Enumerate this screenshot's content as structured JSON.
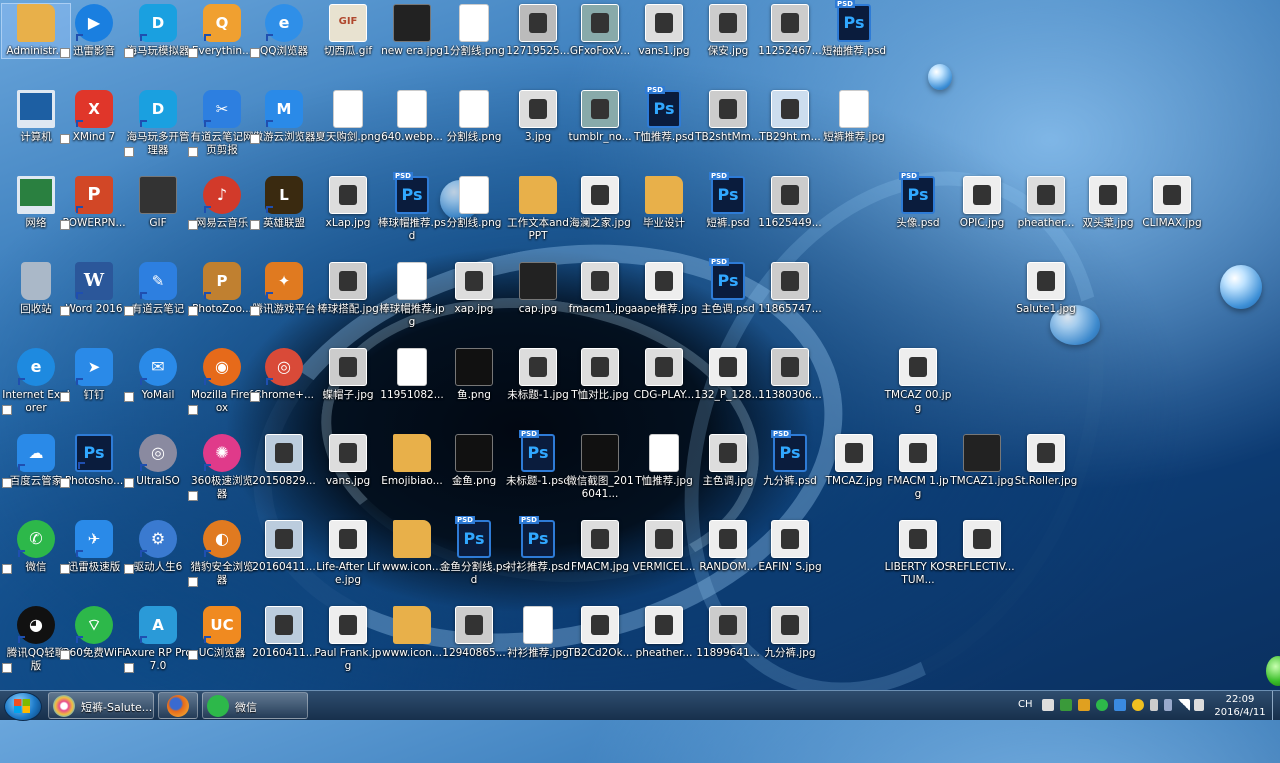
{
  "desktop": {
    "icons": [
      {
        "label": "Administr...",
        "kind": "folder",
        "c": "#e8b04a"
      },
      {
        "label": "迅雷影音",
        "kind": "round",
        "c": "#1a7fe0",
        "g": "▶"
      },
      {
        "label": "海马玩模拟器",
        "kind": "app",
        "c": "#1aa0e0",
        "g": "D"
      },
      {
        "label": "Everythin...",
        "kind": "app",
        "c": "#f0a030",
        "g": "Q"
      },
      {
        "label": "QQ浏览器",
        "kind": "round",
        "c": "#2f8fe8",
        "g": "e"
      },
      {
        "label": "切西瓜.gif",
        "kind": "gif",
        "c": "#e8e2d0"
      },
      {
        "label": "new era.jpg",
        "kind": "dark",
        "c": "#222"
      },
      {
        "label": "1分割线.png",
        "kind": "file",
        "c": "#fff"
      },
      {
        "label": "12719525...",
        "kind": "photo",
        "c": "#bbb"
      },
      {
        "label": "GFxoFoxV...",
        "kind": "photo",
        "c": "#8aa"
      },
      {
        "label": "vans1.jpg",
        "kind": "photo",
        "c": "#ddd"
      },
      {
        "label": "保安.jpg",
        "kind": "photo",
        "c": "#ccc"
      },
      {
        "label": "11252467...",
        "kind": "photo",
        "c": "#ccc"
      },
      {
        "label": "短袖推荐.psd",
        "kind": "psd",
        "c": "#0a1c3d",
        "g": "Ps"
      },
      {
        "label": "计算机",
        "kind": "pc",
        "c": "#1d5fa3"
      },
      {
        "label": "XMind 7",
        "kind": "app",
        "c": "#e0362a",
        "g": "X"
      },
      {
        "label": "海马玩多开管理器",
        "kind": "app",
        "c": "#1aa0e0",
        "g": "D"
      },
      {
        "label": "有道云笔记网页剪报",
        "kind": "app",
        "c": "#2d7fe0",
        "g": "✂"
      },
      {
        "label": "傲游云浏览器",
        "kind": "app",
        "c": "#2a8ae8",
        "g": "M"
      },
      {
        "label": "夏天购剑.png",
        "kind": "file",
        "c": "#fff"
      },
      {
        "label": "640.webp...",
        "kind": "file",
        "c": "#fff"
      },
      {
        "label": "分割线.png",
        "kind": "file",
        "c": "#fff"
      },
      {
        "label": "3.jpg",
        "kind": "photo",
        "c": "#ddd"
      },
      {
        "label": "tumblr_no...",
        "kind": "photo",
        "c": "#8aa"
      },
      {
        "label": "T恤推荐.psd",
        "kind": "psd",
        "c": "#0a1c3d",
        "g": "Ps"
      },
      {
        "label": "TB2shtMm...",
        "kind": "photo",
        "c": "#ccc"
      },
      {
        "label": "TB29ht.m...",
        "kind": "photo",
        "c": "#cde"
      },
      {
        "label": "短裤推荐.jpg",
        "kind": "file",
        "c": "#fff"
      },
      {
        "label": "网络",
        "kind": "pc",
        "c": "#2a8040"
      },
      {
        "label": "POWERPN...",
        "kind": "ppt",
        "c": "#d24726",
        "g": "P"
      },
      {
        "label": "GIF",
        "kind": "dark",
        "c": "#333"
      },
      {
        "label": "网易云音乐",
        "kind": "round",
        "c": "#d23a2a",
        "g": "♪"
      },
      {
        "label": "英雄联盟",
        "kind": "app",
        "c": "#3a2a10",
        "g": "L"
      },
      {
        "label": "xLap.jpg",
        "kind": "photo",
        "c": "#ddd"
      },
      {
        "label": "棒球帽推荐.psd",
        "kind": "psd",
        "c": "#0a1c3d",
        "g": "Ps"
      },
      {
        "label": "分割线.png",
        "kind": "file",
        "c": "#fff"
      },
      {
        "label": "工作文本andPPT",
        "kind": "folder",
        "c": "#e8b04a"
      },
      {
        "label": "海澜之家.jpg",
        "kind": "photo",
        "c": "#eee"
      },
      {
        "label": "毕业设计",
        "kind": "folder",
        "c": "#e8b04a"
      },
      {
        "label": "短裤.psd",
        "kind": "psd",
        "c": "#0a1c3d",
        "g": "Ps"
      },
      {
        "label": "11625449...",
        "kind": "photo",
        "c": "#ccc"
      },
      {
        "label": "头像.psd",
        "kind": "psd",
        "c": "#0a1c3d",
        "g": "Ps"
      },
      {
        "label": "OPIC.jpg",
        "kind": "photo",
        "c": "#eee"
      },
      {
        "label": "pheather...",
        "kind": "photo",
        "c": "#ddd"
      },
      {
        "label": "双头葉.jpg",
        "kind": "photo",
        "c": "#eee"
      },
      {
        "label": "CLIMAX.jpg",
        "kind": "photo",
        "c": "#eee"
      },
      {
        "label": "回收站",
        "kind": "bin",
        "c": "#aab8c8"
      },
      {
        "label": "Word 2016",
        "kind": "word",
        "c": "#2b579a",
        "g": "W"
      },
      {
        "label": "有道云笔记",
        "kind": "app",
        "c": "#2d7fe0",
        "g": "✎"
      },
      {
        "label": "PhotoZoo...",
        "kind": "app",
        "c": "#c08030",
        "g": "P"
      },
      {
        "label": "腾讯游戏平台",
        "kind": "app",
        "c": "#e07a20",
        "g": "✦"
      },
      {
        "label": "棒球搭配.jpg",
        "kind": "photo",
        "c": "#ccc"
      },
      {
        "label": "棒球帽推荐.jpg",
        "kind": "file",
        "c": "#fff"
      },
      {
        "label": "xap.jpg",
        "kind": "photo",
        "c": "#ddd"
      },
      {
        "label": "cap.jpg",
        "kind": "dark",
        "c": "#222"
      },
      {
        "label": "fmacm1.jpg",
        "kind": "photo",
        "c": "#ddd"
      },
      {
        "label": "aape推荐.jpg",
        "kind": "photo",
        "c": "#eee"
      },
      {
        "label": "主色调.psd",
        "kind": "psd",
        "c": "#0a1c3d",
        "g": "Ps"
      },
      {
        "label": "11865747...",
        "kind": "photo",
        "c": "#ccc"
      },
      {
        "label": "Salute1.jpg",
        "kind": "photo",
        "c": "#eee"
      },
      {
        "label": "Internet Explorer",
        "kind": "round",
        "c": "#1e8ae0",
        "g": "e"
      },
      {
        "label": "钉钉",
        "kind": "app",
        "c": "#2a8ae8",
        "g": "➤"
      },
      {
        "label": "YoMail",
        "kind": "round",
        "c": "#2a8ae8",
        "g": "✉"
      },
      {
        "label": "Mozilla Firefox",
        "kind": "round",
        "c": "#e66a1a",
        "g": "◉"
      },
      {
        "label": "Chrome+...",
        "kind": "round",
        "c": "#d94a38",
        "g": "◎"
      },
      {
        "label": "蝶帽子.jpg",
        "kind": "photo",
        "c": "#ccc"
      },
      {
        "label": "11951082...",
        "kind": "file",
        "c": "#fff"
      },
      {
        "label": "鱼.png",
        "kind": "dark",
        "c": "#111"
      },
      {
        "label": "未标题-1.jpg",
        "kind": "photo",
        "c": "#ddd"
      },
      {
        "label": "T恤对比.jpg",
        "kind": "photo",
        "c": "#ddd"
      },
      {
        "label": "CDG-PLAY...",
        "kind": "photo",
        "c": "#ddd"
      },
      {
        "label": "132_P_128...",
        "kind": "photo",
        "c": "#eee"
      },
      {
        "label": "11380306...",
        "kind": "photo",
        "c": "#ccc"
      },
      {
        "label": "TMCAZ 00.jpg",
        "kind": "photo",
        "c": "#eee"
      },
      {
        "label": "百度云管家",
        "kind": "app",
        "c": "#2a8ae8",
        "g": "☁"
      },
      {
        "label": "Photosho...",
        "kind": "ps",
        "c": "#0a1c3d",
        "g": "Ps"
      },
      {
        "label": "UltraISO",
        "kind": "round",
        "c": "#8a8aa0",
        "g": "◎"
      },
      {
        "label": "360极速浏览器",
        "kind": "round",
        "c": "#e03a8a",
        "g": "✺"
      },
      {
        "label": "20150829...",
        "kind": "photo",
        "c": "#bcd"
      },
      {
        "label": "vans.jpg",
        "kind": "photo",
        "c": "#ddd"
      },
      {
        "label": "Emojibiao...",
        "kind": "folder",
        "c": "#e8b04a"
      },
      {
        "label": "金鱼.png",
        "kind": "dark",
        "c": "#111"
      },
      {
        "label": "未标题-1.psd",
        "kind": "psd",
        "c": "#0a1c3d",
        "g": "Ps"
      },
      {
        "label": "微信截图_2016041...",
        "kind": "dark",
        "c": "#111"
      },
      {
        "label": "T恤推荐.jpg",
        "kind": "file",
        "c": "#fff"
      },
      {
        "label": "主色调.jpg",
        "kind": "photo",
        "c": "#ddd"
      },
      {
        "label": "九分裤.psd",
        "kind": "psd",
        "c": "#0a1c3d",
        "g": "Ps"
      },
      {
        "label": "TMCAZ.jpg",
        "kind": "photo",
        "c": "#eee"
      },
      {
        "label": "FMACM 1.jpg",
        "kind": "photo",
        "c": "#eee"
      },
      {
        "label": "TMCAZ1.jpg",
        "kind": "dark",
        "c": "#222"
      },
      {
        "label": "St.Roller.jpg",
        "kind": "photo",
        "c": "#eee"
      },
      {
        "label": "微信",
        "kind": "round",
        "c": "#2db84a",
        "g": "✆"
      },
      {
        "label": "迅雷极速版",
        "kind": "app",
        "c": "#2a8ae8",
        "g": "✈"
      },
      {
        "label": "驱动人生6",
        "kind": "round",
        "c": "#3a7ad0",
        "g": "⚙"
      },
      {
        "label": "猎豹安全浏览器",
        "kind": "round",
        "c": "#e07a20",
        "g": "◐"
      },
      {
        "label": "20160411...",
        "kind": "photo",
        "c": "#bcd"
      },
      {
        "label": "Life-After Life.jpg",
        "kind": "photo",
        "c": "#eee"
      },
      {
        "label": "www.icon...",
        "kind": "folder",
        "c": "#e8b04a"
      },
      {
        "label": "金鱼分割线.psd",
        "kind": "psd",
        "c": "#0a1c3d",
        "g": "Ps"
      },
      {
        "label": "衬衫推荐.psd",
        "kind": "psd",
        "c": "#0a1c3d",
        "g": "Ps"
      },
      {
        "label": "FMACM.jpg",
        "kind": "photo",
        "c": "#ddd"
      },
      {
        "label": "VERMICEL...",
        "kind": "photo",
        "c": "#ddd"
      },
      {
        "label": "RANDOM...",
        "kind": "photo",
        "c": "#eee"
      },
      {
        "label": "EAFIN' S.jpg",
        "kind": "photo",
        "c": "#eee"
      },
      {
        "label": "LIBERTY KOSTUM...",
        "kind": "photo",
        "c": "#eee"
      },
      {
        "label": "REFLECTIV...",
        "kind": "photo",
        "c": "#eee"
      },
      {
        "label": "腾讯QQ轻聊版",
        "kind": "round",
        "c": "#111",
        "g": "◕"
      },
      {
        "label": "360免费WiFi",
        "kind": "round",
        "c": "#2db84a",
        "g": "⌔"
      },
      {
        "label": "Axure RP Pro 7.0",
        "kind": "app",
        "c": "#2a9ad8",
        "g": "A"
      },
      {
        "label": "UC浏览器",
        "kind": "app",
        "c": "#f08a20",
        "g": "UC"
      },
      {
        "label": "20160411...",
        "kind": "photo",
        "c": "#bcd"
      },
      {
        "label": "Paul Frank.jpg",
        "kind": "photo",
        "c": "#eee"
      },
      {
        "label": "www.icon...",
        "kind": "folder",
        "c": "#e8b04a"
      },
      {
        "label": "12940865...",
        "kind": "photo",
        "c": "#ccc"
      },
      {
        "label": "衬衫推荐.jpg",
        "kind": "file",
        "c": "#fff"
      },
      {
        "label": "TB2Cd2Ok...",
        "kind": "photo",
        "c": "#eee"
      },
      {
        "label": "pheather...",
        "kind": "photo",
        "c": "#eee"
      },
      {
        "label": "11899641...",
        "kind": "photo",
        "c": "#ccc"
      },
      {
        "label": "九分裤.jpg",
        "kind": "photo",
        "c": "#ddd"
      }
    ]
  },
  "taskbar": {
    "tasks": [
      {
        "label": "短裤-Salute...",
        "c": "#e84a8a"
      },
      {
        "label": "",
        "c": "#e66a1a"
      },
      {
        "label": "微信",
        "c": "#2db84a"
      }
    ],
    "tray_text": "CH",
    "time": "22:09",
    "date": "2016/4/11"
  }
}
